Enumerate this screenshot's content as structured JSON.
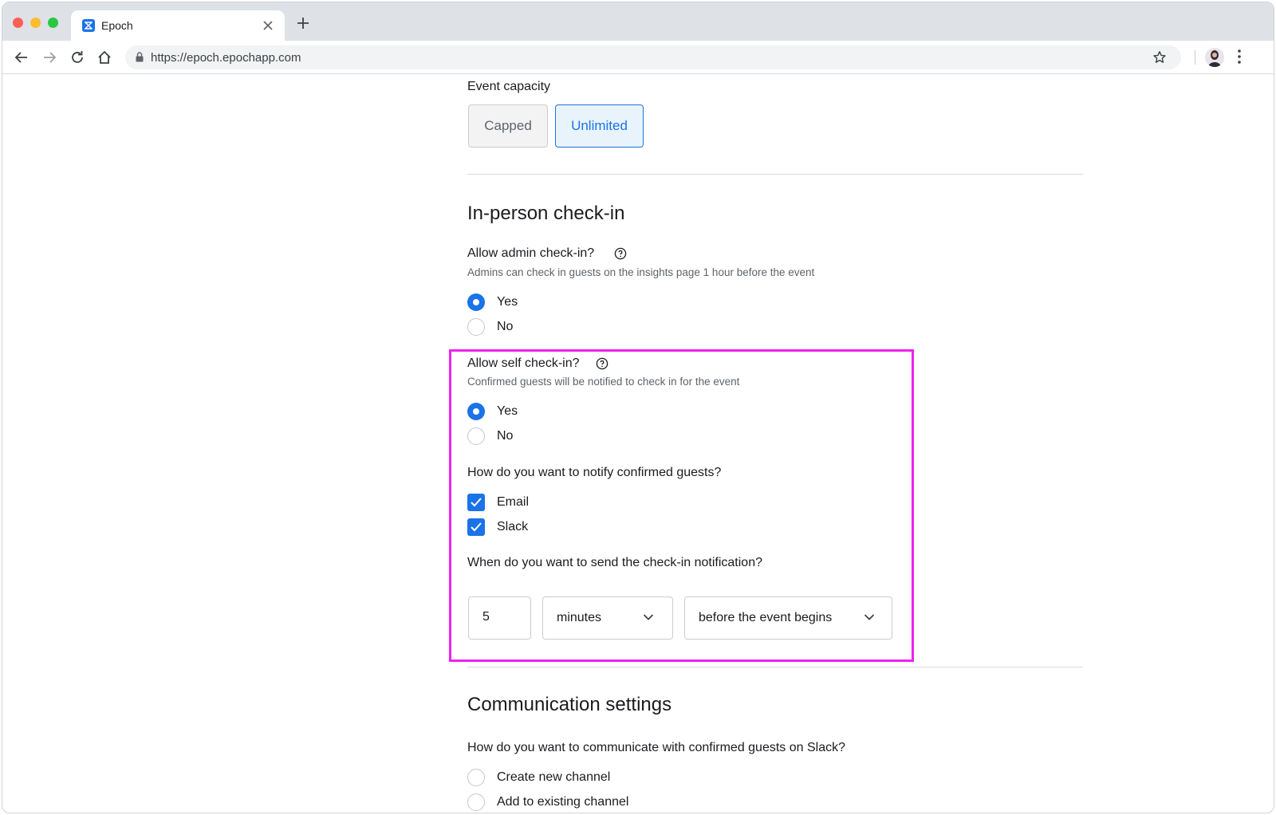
{
  "browser": {
    "tab_title": "Epoch",
    "url": "https://epoch.epochapp.com"
  },
  "capacity": {
    "label": "Event capacity",
    "options": [
      "Capped",
      "Unlimited"
    ],
    "selected": "Unlimited"
  },
  "checkin": {
    "heading": "In-person check-in",
    "admin": {
      "label": "Allow admin check-in?",
      "description": "Admins can check in guests on the insights page 1 hour before the event",
      "options": [
        "Yes",
        "No"
      ],
      "selected": "Yes"
    },
    "self": {
      "label": "Allow self check-in?",
      "description": "Confirmed guests will be notified to check in for the event",
      "options": [
        "Yes",
        "No"
      ],
      "selected": "Yes"
    },
    "notify": {
      "label": "How do you want to notify confirmed guests?",
      "options": [
        "Email",
        "Slack"
      ],
      "checked": [
        "Email",
        "Slack"
      ]
    },
    "timing": {
      "label": "When do you want to send the check-in notification?",
      "amount": "5",
      "unit": "minutes",
      "relation": "before the event begins"
    }
  },
  "communication": {
    "heading": "Communication settings",
    "question": "How do you want to communicate with confirmed guests on Slack?",
    "options": [
      "Create new channel",
      "Add to existing channel"
    ],
    "selected": null
  },
  "colors": {
    "accent": "#1a73e8",
    "highlight": "#ee22ee"
  },
  "icons": [
    "back-icon",
    "forward-icon",
    "reload-icon",
    "home-icon",
    "lock-icon",
    "star-icon",
    "help-icon",
    "chevron-down-icon",
    "check-icon",
    "close-icon",
    "plus-icon",
    "menu-icon"
  ]
}
